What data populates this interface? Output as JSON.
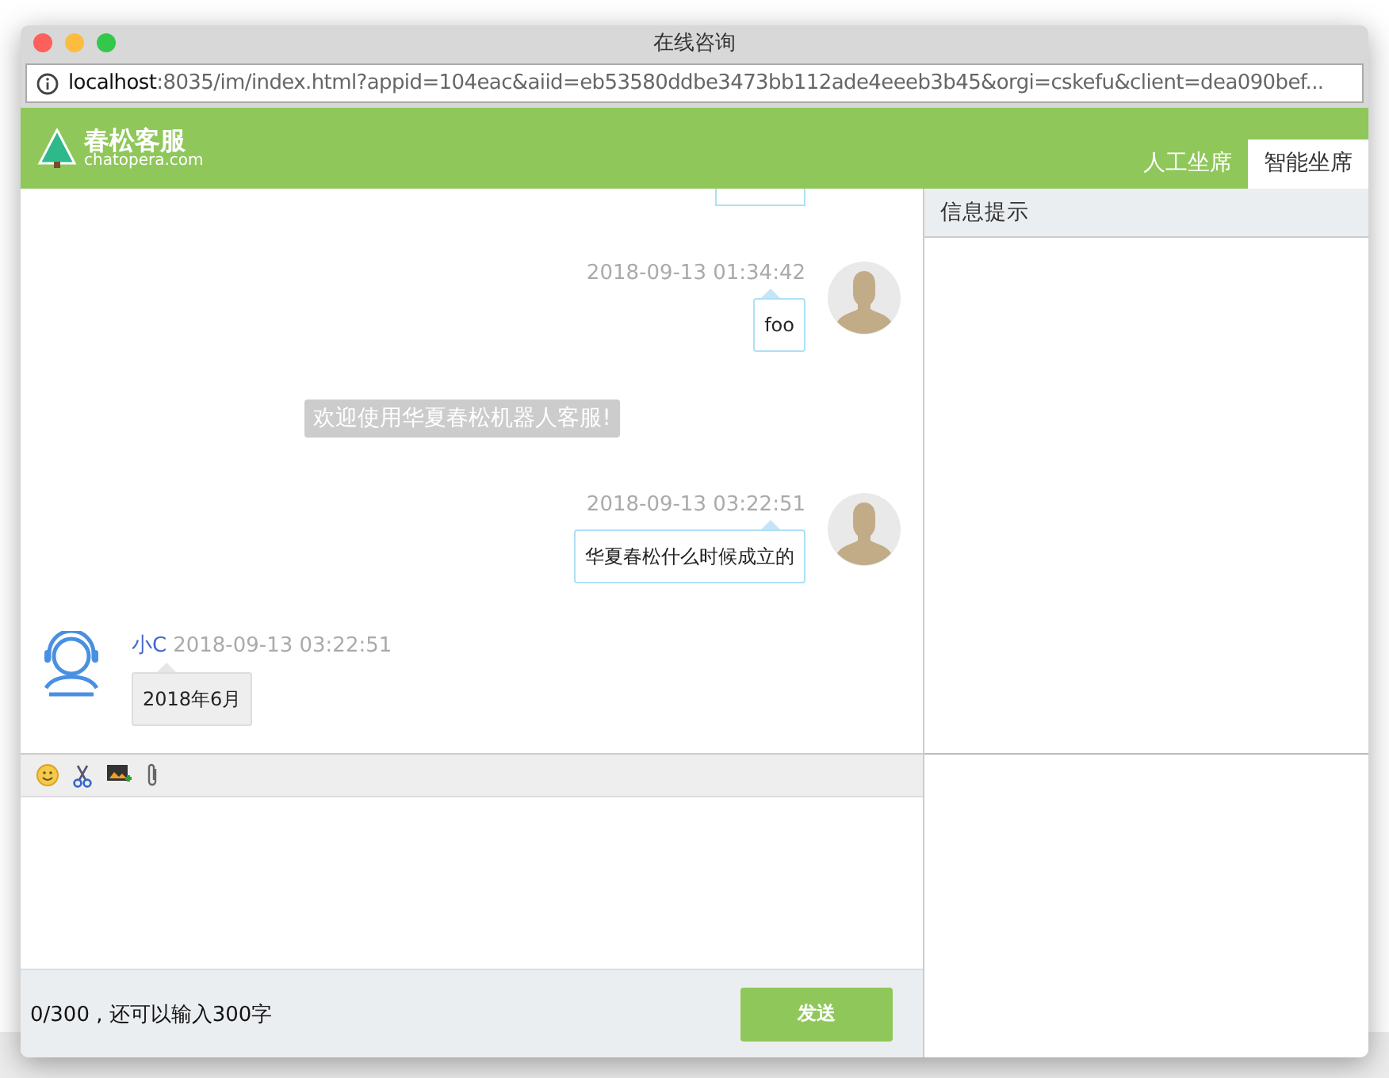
{
  "window": {
    "title": "在线咨询"
  },
  "address_bar": {
    "host": "localhost",
    "path": ":8035/im/index.html?appid=104eac&aiid=eb53580ddbe3473bb112ade4eeeb3b45&orgi=cskefu&client=dea090bef..."
  },
  "header": {
    "logo_title": "春松客服",
    "logo_subtitle": "chatopera.com"
  },
  "tabs": [
    {
      "label": "人工坐席",
      "selected": false
    },
    {
      "label": "智能坐席",
      "selected": true
    }
  ],
  "messages": [
    {
      "kind": "clipped"
    },
    {
      "kind": "user",
      "time": "2018-09-13 01:34:42",
      "text": "foo"
    },
    {
      "kind": "system",
      "text": "欢迎使用华夏春松机器人客服!"
    },
    {
      "kind": "user",
      "time": "2018-09-13 03:22:51",
      "text": "华夏春松什么时候成立的"
    },
    {
      "kind": "agent",
      "name": "小C",
      "time": "2018-09-13 03:22:51",
      "text": "2018年6月"
    }
  ],
  "composer": {
    "counter": "0/300 , 还可以输入300字",
    "send_button": "发送"
  },
  "info_panel": {
    "title": "信息提示"
  }
}
